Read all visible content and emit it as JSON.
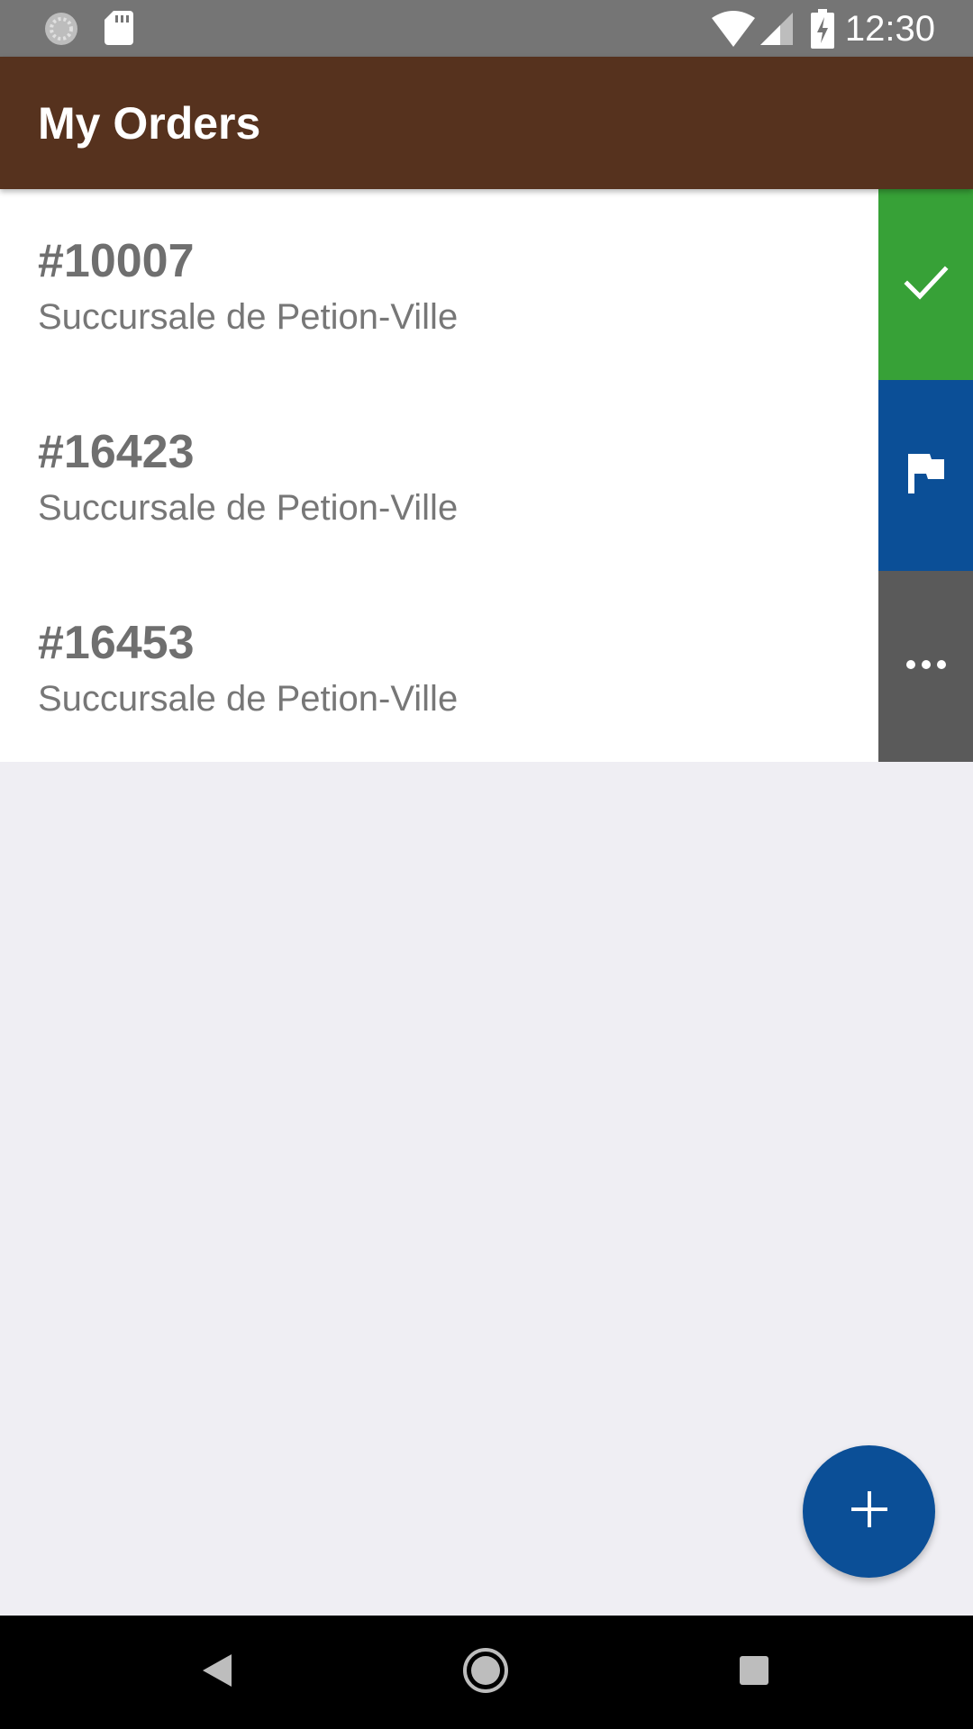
{
  "status_bar": {
    "time": "12:30",
    "icons": [
      "sync-icon",
      "sd-card-icon",
      "wifi-icon",
      "cell-signal-icon",
      "battery-charging-icon"
    ]
  },
  "app_bar": {
    "title": "My Orders",
    "color": "#56321e"
  },
  "orders": [
    {
      "number": "#10007",
      "branch": "Succursale de Petion-Ville"
    },
    {
      "number": "#16423",
      "branch": "Succursale de Petion-Ville"
    },
    {
      "number": "#16453",
      "branch": "Succursale de Petion-Ville"
    }
  ],
  "side_actions": [
    {
      "icon": "check-icon",
      "color": "#37a137"
    },
    {
      "icon": "flag-icon",
      "color": "#0b4f97"
    },
    {
      "icon": "more-horizontal-icon",
      "color": "#5a5a5a"
    }
  ],
  "fab": {
    "icon": "plus-icon",
    "color": "#0b4f97"
  },
  "nav_bar": {
    "buttons": [
      "back-icon",
      "home-icon",
      "recents-icon"
    ]
  }
}
